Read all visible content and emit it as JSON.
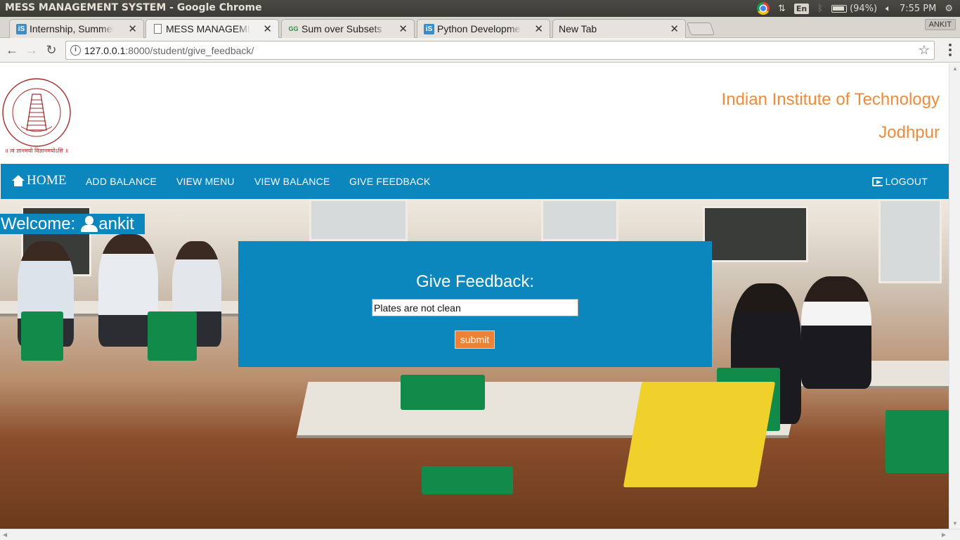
{
  "os": {
    "window_title": "MESS MANAGEMENT SYSTEM - Google Chrome",
    "keyboard_layout": "En",
    "battery": "(94%)",
    "clock": "7:55 PM"
  },
  "browser": {
    "tabs": [
      {
        "label": "Internship, Summer",
        "favicon": "is-icon"
      },
      {
        "label": "MESS MANAGEMEN",
        "favicon": "document-icon"
      },
      {
        "label": "Sum over Subsets |",
        "favicon": "gfg-icon"
      },
      {
        "label": "Python Developme",
        "favicon": "is-icon"
      },
      {
        "label": "New Tab",
        "favicon": ""
      }
    ],
    "profile": "ANKIT",
    "url_host": "127.0.0.1",
    "url_path": ":8000/student/give_feedback/"
  },
  "header": {
    "institute_line1": "Indian Institute of Technology",
    "institute_line2": "Jodhpur",
    "logo_motto": "॥ त्वं ज्ञानमयो विज्ञानमयोऽसि ॥"
  },
  "nav": {
    "home": "HOME",
    "items": [
      "ADD BALANCE",
      "VIEW MENU",
      "VIEW BALANCE",
      "GIVE FEEDBACK"
    ],
    "logout": "LOGOUT"
  },
  "welcome": {
    "prefix": "Welcome:",
    "username": "ankit"
  },
  "feedback": {
    "heading": "Give Feedback:",
    "value": "Plates are not clean",
    "submit": "submit"
  },
  "colors": {
    "brand_blue": "#0b87bd",
    "accent_orange": "#ee8234"
  }
}
